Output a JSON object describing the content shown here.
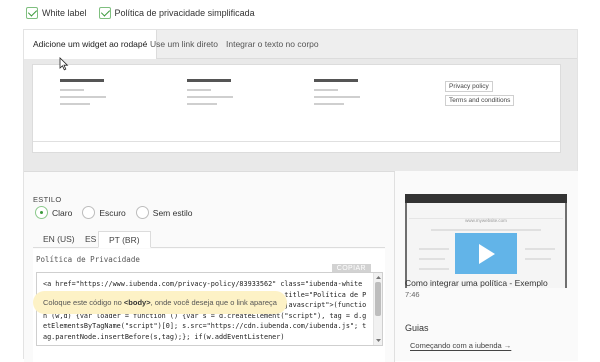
{
  "checkboxes": [
    {
      "label": "White label",
      "checked": true
    },
    {
      "label": "Política de privacidade simplificada",
      "checked": true
    }
  ],
  "tabs": [
    {
      "label": "Adicione um widget ao rodapé",
      "active": true
    },
    {
      "label": "Use um link direto",
      "active": false
    },
    {
      "label": "Integrar o texto no corpo",
      "active": false
    }
  ],
  "preview": {
    "privacy_button": "Privacy policy",
    "terms_button": "Terms and conditions"
  },
  "style_section": {
    "label": "ESTILO",
    "options": [
      {
        "label": "Claro",
        "selected": true
      },
      {
        "label": "Escuro",
        "selected": false
      },
      {
        "label": "Sem estilo",
        "selected": false
      }
    ]
  },
  "language_tabs": [
    {
      "label": "EN (US)",
      "active": false
    },
    {
      "label": "ES",
      "active": false
    },
    {
      "label": "PT (BR)",
      "active": true
    }
  ],
  "code": {
    "field_label": "Política de Privacidade",
    "copy_label": "COPIAR",
    "snippet": "<a href=\"https://www.iubenda.com/privacy-policy/83933562\" class=\"iubenda-white no-brand iubenda-noiframe iubenda-embed iubenda-noiframe \" title=\"Política de Privacidade \">Política de Privacidade</a><script type=\"text/javascript\">(function (w,d) {var loader = function () {var s = d.createElement(\"script\"), tag = d.getElementsByTagName(\"script\")[0]; s.src=\"https://cdn.iubenda.com/iubenda.js\"; tag.parentNode.insertBefore(s,tag);}; if(w.addEventListener)"
  },
  "tip": {
    "prefix": "Coloque este código no ",
    "tag": "<body>",
    "suffix": ", onde você deseja que o link apareça"
  },
  "video": {
    "url_text": "www.mywebsite.com",
    "title": "Como integrar uma política - Exemplo",
    "duration": "7:46"
  },
  "guides": {
    "title": "Guias",
    "link": "Começando com a iubenda →"
  },
  "colors": {
    "check_green": "#3d9a3d",
    "tip_bg": "#fdf2c6",
    "video_accent": "#62b4e8"
  }
}
